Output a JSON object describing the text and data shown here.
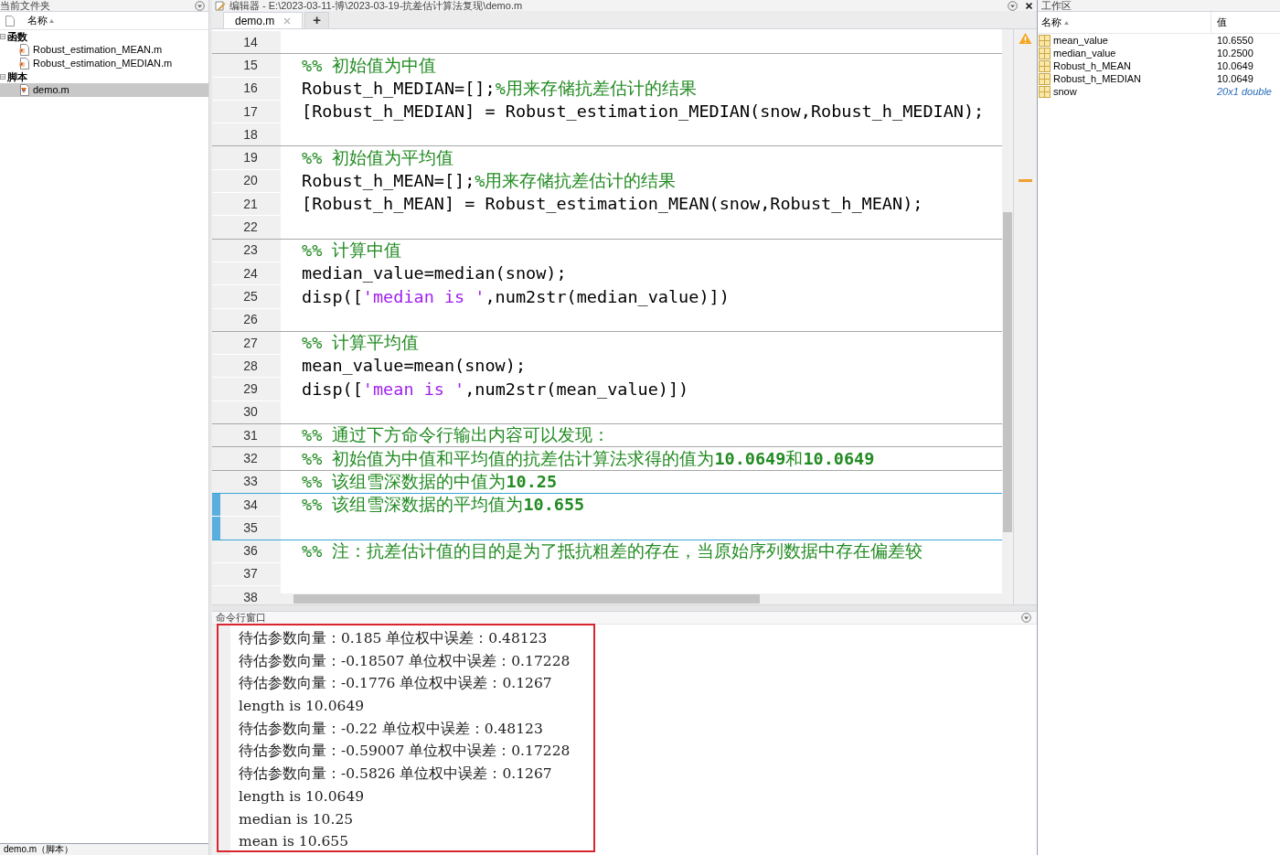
{
  "current_folder": {
    "title": "当前文件夹",
    "column": "名称",
    "groups": [
      {
        "label": "函数",
        "expanded": true,
        "files": [
          {
            "name": "Robust_estimation_MEAN.m",
            "kind": "function",
            "selected": false
          },
          {
            "name": "Robust_estimation_MEDIAN.m",
            "kind": "function",
            "selected": false
          }
        ]
      },
      {
        "label": "脚本",
        "expanded": true,
        "files": [
          {
            "name": "demo.m",
            "kind": "script",
            "selected": true
          }
        ]
      }
    ],
    "details": "demo.m（脚本）"
  },
  "editor": {
    "title": "编辑器 - E:\\2023-03-11-博\\2023-03-19-抗差估计算法复现\\demo.m",
    "tabs": [
      {
        "label": "demo.m",
        "selected": true
      }
    ],
    "add_tab": "+",
    "lines": [
      {
        "number": "14",
        "divider": false,
        "current": false
      },
      {
        "number": "15",
        "divider": true,
        "current": false,
        "segments": [
          {
            "kind": "comment",
            "text": "%% 初始值为中值"
          }
        ]
      },
      {
        "number": "16",
        "divider": false,
        "current": false,
        "segments": [
          {
            "kind": "code",
            "text": "Robust_h_MEDIAN=[];"
          },
          {
            "kind": "comment",
            "text": "%用来存储抗差估计的结果"
          }
        ]
      },
      {
        "number": "17",
        "divider": false,
        "current": false,
        "segments": [
          {
            "kind": "code",
            "text": "[Robust_h_MEDIAN] = Robust_estimation_MEDIAN(snow,Robust_h_MEDIAN);"
          }
        ]
      },
      {
        "number": "18",
        "divider": false,
        "current": false
      },
      {
        "number": "19",
        "divider": true,
        "current": false,
        "segments": [
          {
            "kind": "comment",
            "text": "%% 初始值为平均值"
          }
        ]
      },
      {
        "number": "20",
        "divider": false,
        "current": false,
        "segments": [
          {
            "kind": "code",
            "text": "Robust_h_MEAN=[];"
          },
          {
            "kind": "comment",
            "text": "%用来存储抗差估计的结果"
          }
        ]
      },
      {
        "number": "21",
        "divider": false,
        "current": false,
        "segments": [
          {
            "kind": "code",
            "text": "[Robust_h_MEAN] = Robust_estimation_MEAN(snow,Robust_h_MEAN);"
          }
        ]
      },
      {
        "number": "22",
        "divider": false,
        "current": false
      },
      {
        "number": "23",
        "divider": true,
        "current": false,
        "segments": [
          {
            "kind": "comment",
            "text": "%% 计算中值"
          }
        ]
      },
      {
        "number": "24",
        "divider": false,
        "current": false,
        "segments": [
          {
            "kind": "code",
            "text": "median_value=median(snow);"
          }
        ]
      },
      {
        "number": "25",
        "divider": false,
        "current": false,
        "segments": [
          {
            "kind": "code",
            "text": "disp(["
          },
          {
            "kind": "string",
            "text": "'median is '"
          },
          {
            "kind": "code",
            "text": ",num2str(median_value)])"
          }
        ]
      },
      {
        "number": "26",
        "divider": false,
        "current": false
      },
      {
        "number": "27",
        "divider": true,
        "current": false,
        "segments": [
          {
            "kind": "comment",
            "text": "%% 计算平均值"
          }
        ]
      },
      {
        "number": "28",
        "divider": false,
        "current": false,
        "segments": [
          {
            "kind": "code",
            "text": "mean_value=mean(snow);"
          }
        ]
      },
      {
        "number": "29",
        "divider": false,
        "current": false,
        "segments": [
          {
            "kind": "code",
            "text": "disp(["
          },
          {
            "kind": "string",
            "text": "'mean is '"
          },
          {
            "kind": "code",
            "text": ",num2str(mean_value)])"
          }
        ]
      },
      {
        "number": "30",
        "divider": false,
        "current": false
      },
      {
        "number": "31",
        "divider": true,
        "current": false,
        "segments": [
          {
            "kind": "comment",
            "text": "%% 通过下方命令行输出内容可以发现："
          }
        ]
      },
      {
        "number": "32",
        "divider": true,
        "current": false,
        "segments": [
          {
            "kind": "comment",
            "text": "%% 初始值为中值和平均值的抗差估计算法求得的值为**10.0649**和**10.0649**"
          }
        ]
      },
      {
        "number": "33",
        "divider": true,
        "current": false,
        "segments": [
          {
            "kind": "comment",
            "text": "%% 该组雪深数据的中值为**10.25**"
          }
        ]
      },
      {
        "number": "34",
        "divider": true,
        "current": true,
        "segments": [
          {
            "kind": "comment",
            "text": "%% 该组雪深数据的平均值为**10.655**"
          }
        ]
      },
      {
        "number": "35",
        "divider": false,
        "current": true
      },
      {
        "number": "36",
        "divider": true,
        "current": false,
        "segments": [
          {
            "kind": "comment",
            "text": "%% 注：抗差估计值的目的是为了抵抗粗差的存在，当原始序列数据中存在偏差较"
          }
        ]
      },
      {
        "number": "37",
        "divider": false,
        "current": false
      },
      {
        "number": "38",
        "divider": false,
        "current": false
      }
    ]
  },
  "command_window": {
    "title": "命令行窗口",
    "lines": [
      "待估参数向量：0.185 单位权中误差：0.48123",
      "待估参数向量：-0.18507 单位权中误差：0.17228",
      "待估参数向量：-0.1776 单位权中误差：0.1267",
      "length is 10.0649",
      "待估参数向量：-0.22 单位权中误差：0.48123",
      "待估参数向量：-0.59007 单位权中误差：0.17228",
      "待估参数向量：-0.5826 单位权中误差：0.1267",
      "length is 10.0649",
      "median is 10.25",
      "mean is 10.655"
    ]
  },
  "workspace": {
    "title": "工作区",
    "columns": [
      "名称",
      "值"
    ],
    "rows": [
      {
        "name": "mean_value",
        "value": "10.6550",
        "kind": "scalar"
      },
      {
        "name": "median_value",
        "value": "10.2500",
        "kind": "scalar"
      },
      {
        "name": "Robust_h_MEAN",
        "value": "10.0649",
        "kind": "scalar"
      },
      {
        "name": "Robust_h_MEDIAN",
        "value": "10.0649",
        "kind": "scalar"
      },
      {
        "name": "snow",
        "value": "20x1 double",
        "kind": "array"
      }
    ]
  }
}
